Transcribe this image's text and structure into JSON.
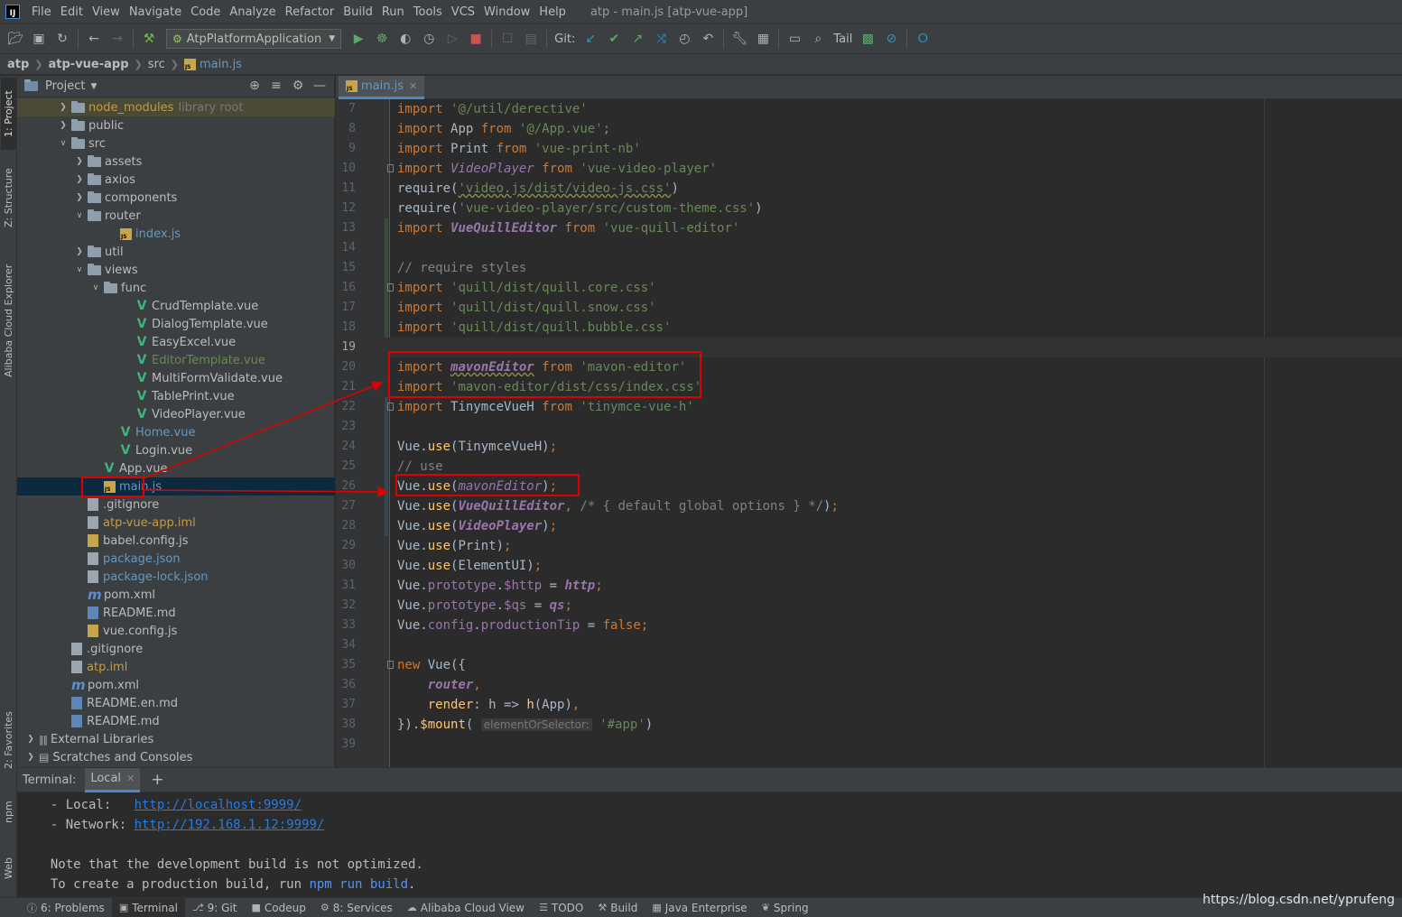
{
  "menubar": {
    "items": [
      "File",
      "Edit",
      "View",
      "Navigate",
      "Code",
      "Analyze",
      "Refactor",
      "Build",
      "Run",
      "Tools",
      "VCS",
      "Window",
      "Help"
    ],
    "window_title": "atp - main.js [atp-vue-app]"
  },
  "toolbar": {
    "run_config": "AtpPlatformApplication",
    "git_label": "Git:",
    "tail_label": "Tail"
  },
  "breadcrumb": {
    "items": [
      "atp",
      "atp-vue-app",
      "src",
      "main.js"
    ]
  },
  "left_strip": {
    "tabs": [
      "1: Project",
      "Z: Structure",
      "Alibaba Cloud Explorer",
      "2: Favorites",
      "npm",
      "Web"
    ]
  },
  "project_panel": {
    "title": "Project",
    "tree": [
      {
        "label": "node_modules",
        "suffix": "library root",
        "depth": 2,
        "type": "folder",
        "expanded": false,
        "style": "excluded"
      },
      {
        "label": "public",
        "depth": 2,
        "type": "folder",
        "expanded": false
      },
      {
        "label": "src",
        "depth": 2,
        "type": "folder",
        "expanded": true
      },
      {
        "label": "assets",
        "depth": 3,
        "type": "folder",
        "expanded": false
      },
      {
        "label": "axios",
        "depth": 3,
        "type": "folder",
        "expanded": false
      },
      {
        "label": "components",
        "depth": 3,
        "type": "folder",
        "expanded": false
      },
      {
        "label": "router",
        "depth": 3,
        "type": "folder",
        "expanded": true
      },
      {
        "label": "index.js",
        "depth": 5,
        "type": "js",
        "color": "blue"
      },
      {
        "label": "util",
        "depth": 3,
        "type": "folder",
        "expanded": false
      },
      {
        "label": "views",
        "depth": 3,
        "type": "folder",
        "expanded": true
      },
      {
        "label": "func",
        "depth": 4,
        "type": "folder",
        "expanded": true
      },
      {
        "label": "CrudTemplate.vue",
        "depth": 6,
        "type": "vue"
      },
      {
        "label": "DialogTemplate.vue",
        "depth": 6,
        "type": "vue"
      },
      {
        "label": "EasyExcel.vue",
        "depth": 6,
        "type": "vue"
      },
      {
        "label": "EditorTemplate.vue",
        "depth": 6,
        "type": "vue",
        "color": "green"
      },
      {
        "label": "MultiFormValidate.vue",
        "depth": 6,
        "type": "vue"
      },
      {
        "label": "TablePrint.vue",
        "depth": 6,
        "type": "vue"
      },
      {
        "label": "VideoPlayer.vue",
        "depth": 6,
        "type": "vue"
      },
      {
        "label": "Home.vue",
        "depth": 5,
        "type": "vue",
        "color": "blue"
      },
      {
        "label": "Login.vue",
        "depth": 5,
        "type": "vue"
      },
      {
        "label": "App.vue",
        "depth": 4,
        "type": "vue"
      },
      {
        "label": "main.js",
        "depth": 4,
        "type": "js",
        "color": "blue",
        "selected": true
      },
      {
        "label": ".gitignore",
        "depth": 3,
        "type": "file"
      },
      {
        "label": "atp-vue-app.iml",
        "depth": 3,
        "type": "file",
        "color": "orange"
      },
      {
        "label": "babel.config.js",
        "depth": 3,
        "type": "jsfile"
      },
      {
        "label": "package.json",
        "depth": 3,
        "type": "file",
        "color": "blue"
      },
      {
        "label": "package-lock.json",
        "depth": 3,
        "type": "file",
        "color": "blue"
      },
      {
        "label": "pom.xml",
        "depth": 3,
        "type": "maven"
      },
      {
        "label": "README.md",
        "depth": 3,
        "type": "md"
      },
      {
        "label": "vue.config.js",
        "depth": 3,
        "type": "jsfile"
      },
      {
        "label": ".gitignore",
        "depth": 2,
        "type": "file"
      },
      {
        "label": "atp.iml",
        "depth": 2,
        "type": "file",
        "color": "orange"
      },
      {
        "label": "pom.xml",
        "depth": 2,
        "type": "maven"
      },
      {
        "label": "README.en.md",
        "depth": 2,
        "type": "md"
      },
      {
        "label": "README.md",
        "depth": 2,
        "type": "md"
      },
      {
        "label": "External Libraries",
        "depth": 0,
        "type": "lib",
        "expanded": false
      },
      {
        "label": "Scratches and Consoles",
        "depth": 0,
        "type": "scratch",
        "expanded": false
      }
    ]
  },
  "editor": {
    "tab_label": "main.js",
    "lines": [
      {
        "n": "7",
        "seg": [
          [
            "kw",
            "import "
          ],
          [
            "str",
            "'@/util/derective'"
          ]
        ]
      },
      {
        "n": "8",
        "seg": [
          [
            "kw",
            "import "
          ],
          [
            "pl",
            "App "
          ],
          [
            "kw",
            "from "
          ],
          [
            "str",
            "'@/App.vue'"
          ],
          [
            "kw",
            ";"
          ]
        ]
      },
      {
        "n": "9",
        "seg": [
          [
            "kw",
            "import "
          ],
          [
            "pl",
            "Print "
          ],
          [
            "kw",
            "from "
          ],
          [
            "str",
            "'vue-print-nb'"
          ]
        ]
      },
      {
        "n": "10",
        "fold": true,
        "seg": [
          [
            "kw",
            "import "
          ],
          [
            "ital",
            "VideoPlayer "
          ],
          [
            "kw",
            "from "
          ],
          [
            "str",
            "'vue-video-player'"
          ]
        ]
      },
      {
        "n": "11",
        "seg": [
          [
            "pl",
            "require("
          ],
          [
            "strsq",
            "'video.js/dist/video-js.css'"
          ],
          [
            "pl",
            ")"
          ]
        ]
      },
      {
        "n": "12",
        "seg": [
          [
            "pl",
            "require("
          ],
          [
            "str",
            "'vue-video-player/src/custom-theme.css'"
          ],
          [
            "pl",
            ")"
          ]
        ]
      },
      {
        "n": "13",
        "mark": "green",
        "seg": [
          [
            "kw",
            "import "
          ],
          [
            "itb",
            "VueQuillEditor "
          ],
          [
            "kw",
            "from "
          ],
          [
            "str",
            "'vue-quill-editor'"
          ]
        ]
      },
      {
        "n": "14",
        "mark": "green",
        "seg": []
      },
      {
        "n": "15",
        "mark": "green",
        "seg": [
          [
            "cmt",
            "// require styles"
          ]
        ]
      },
      {
        "n": "16",
        "mark": "green",
        "fold": true,
        "seg": [
          [
            "kw",
            "import "
          ],
          [
            "str",
            "'quill/dist/quill.core.css'"
          ]
        ]
      },
      {
        "n": "17",
        "mark": "green",
        "seg": [
          [
            "kw",
            "import "
          ],
          [
            "str",
            "'quill/dist/quill.snow.css'"
          ]
        ]
      },
      {
        "n": "18",
        "mark": "green",
        "seg": [
          [
            "kw",
            "import "
          ],
          [
            "str",
            "'quill/dist/quill.bubble.css'"
          ]
        ]
      },
      {
        "n": "19",
        "current": true,
        "seg": []
      },
      {
        "n": "20",
        "seg": [
          [
            "kw",
            "import "
          ],
          [
            "itbsq",
            "mavonEditor"
          ],
          [
            "pl",
            " "
          ],
          [
            "kw",
            "from "
          ],
          [
            "str",
            "'mavon-editor'"
          ]
        ]
      },
      {
        "n": "21",
        "seg": [
          [
            "kw",
            "import "
          ],
          [
            "str",
            "'mavon-editor/dist/css/index.css'"
          ]
        ]
      },
      {
        "n": "22",
        "fold": true,
        "mark": "blue",
        "seg": [
          [
            "kw",
            "import "
          ],
          [
            "pl",
            "TinymceVueH "
          ],
          [
            "kw",
            "from "
          ],
          [
            "str",
            "'tinymce-vue-h'"
          ]
        ]
      },
      {
        "n": "23",
        "mark": "blue",
        "seg": []
      },
      {
        "n": "24",
        "mark": "blue",
        "seg": [
          [
            "pl",
            "Vue."
          ],
          [
            "fn",
            "use"
          ],
          [
            "pl",
            "(TinymceVueH)"
          ],
          [
            "kw",
            ";"
          ]
        ]
      },
      {
        "n": "25",
        "mark": "blue",
        "seg": [
          [
            "cmt",
            "// use"
          ]
        ]
      },
      {
        "n": "26",
        "mark": "blue",
        "seg": [
          [
            "pl",
            "Vue."
          ],
          [
            "fn",
            "use"
          ],
          [
            "pl",
            "("
          ],
          [
            "ital",
            "mavonEditor"
          ],
          [
            "pl",
            ")"
          ],
          [
            "kw",
            ";"
          ]
        ]
      },
      {
        "n": "27",
        "mark": "blue",
        "seg": [
          [
            "pl",
            "Vue."
          ],
          [
            "fn",
            "use"
          ],
          [
            "pl",
            "("
          ],
          [
            "itb",
            "VueQuillEditor"
          ],
          [
            "kw",
            ", "
          ],
          [
            "cmt",
            "/* { default global options } */"
          ],
          [
            "pl",
            ")"
          ],
          [
            "kw",
            ";"
          ]
        ]
      },
      {
        "n": "28",
        "mark": "blue",
        "seg": [
          [
            "pl",
            "Vue."
          ],
          [
            "fn",
            "use"
          ],
          [
            "pl",
            "("
          ],
          [
            "itb",
            "VideoPlayer"
          ],
          [
            "pl",
            ")"
          ],
          [
            "kw",
            ";"
          ]
        ]
      },
      {
        "n": "29",
        "seg": [
          [
            "pl",
            "Vue."
          ],
          [
            "fn",
            "use"
          ],
          [
            "pl",
            "(Print)"
          ],
          [
            "kw",
            ";"
          ]
        ]
      },
      {
        "n": "30",
        "seg": [
          [
            "pl",
            "Vue."
          ],
          [
            "fn",
            "use"
          ],
          [
            "pl",
            "(ElementUI)"
          ],
          [
            "kw",
            ";"
          ]
        ]
      },
      {
        "n": "31",
        "seg": [
          [
            "pl",
            "Vue."
          ],
          [
            "prop",
            "prototype"
          ],
          [
            "pl",
            "."
          ],
          [
            "prop",
            "$http"
          ],
          [
            "pl",
            " = "
          ],
          [
            "itb",
            "http"
          ],
          [
            "kw",
            ";"
          ]
        ]
      },
      {
        "n": "32",
        "seg": [
          [
            "pl",
            "Vue."
          ],
          [
            "prop",
            "prototype"
          ],
          [
            "pl",
            "."
          ],
          [
            "prop",
            "$qs"
          ],
          [
            "pl",
            " = "
          ],
          [
            "itb",
            "qs"
          ],
          [
            "kw",
            ";"
          ]
        ]
      },
      {
        "n": "33",
        "seg": [
          [
            "pl",
            "Vue."
          ],
          [
            "prop",
            "config"
          ],
          [
            "pl",
            "."
          ],
          [
            "prop",
            "productionTip"
          ],
          [
            "pl",
            " = "
          ],
          [
            "kw",
            "false;"
          ]
        ]
      },
      {
        "n": "34",
        "seg": []
      },
      {
        "n": "35",
        "fold": true,
        "seg": [
          [
            "kw",
            "new "
          ],
          [
            "pl",
            "Vue({"
          ]
        ]
      },
      {
        "n": "36",
        "seg": [
          [
            "pl",
            "    "
          ],
          [
            "itb",
            "router"
          ],
          [
            "kw",
            ","
          ]
        ]
      },
      {
        "n": "37",
        "seg": [
          [
            "pl",
            "    "
          ],
          [
            "fn",
            "render"
          ],
          [
            "pl",
            ": h => "
          ],
          [
            "fn",
            "h"
          ],
          [
            "pl",
            "(App)"
          ],
          [
            "kw",
            ","
          ]
        ]
      },
      {
        "n": "38",
        "seg": [
          [
            "pl",
            "})."
          ],
          [
            "fn",
            "$mount"
          ],
          [
            "pl",
            "( "
          ],
          [
            "hint",
            "elementOrSelector:"
          ],
          [
            "pl",
            " "
          ],
          [
            "str",
            "'#app'"
          ],
          [
            "pl",
            ")"
          ]
        ]
      },
      {
        "n": "39",
        "seg": []
      }
    ]
  },
  "terminal": {
    "label": "Terminal:",
    "tab": "Local",
    "lines": [
      {
        "parts": [
          [
            "t",
            "  - Local:   "
          ],
          [
            "link",
            "http://localhost:9999/"
          ]
        ]
      },
      {
        "parts": [
          [
            "t",
            "  - Network: "
          ],
          [
            "link",
            "http://192.168.1.12:9999/"
          ]
        ]
      },
      {
        "parts": []
      },
      {
        "parts": [
          [
            "t",
            "  Note that the development build is not optimized."
          ]
        ]
      },
      {
        "parts": [
          [
            "t",
            "  To create a production build, run "
          ],
          [
            "cmd",
            "npm run build"
          ],
          [
            "t",
            "."
          ]
        ]
      }
    ]
  },
  "statusbar": {
    "items": [
      {
        "label": "6: Problems",
        "icon": "problems-icon"
      },
      {
        "label": "Terminal",
        "icon": "terminal-icon",
        "active": true
      },
      {
        "label": "9: Git",
        "icon": "git-icon"
      },
      {
        "label": "Codeup",
        "icon": "codeup-icon"
      },
      {
        "label": "8: Services",
        "icon": "services-icon"
      },
      {
        "label": "Alibaba Cloud View",
        "icon": "cloud-icon"
      },
      {
        "label": "TODO",
        "icon": "todo-icon"
      },
      {
        "label": "Build",
        "icon": "build-icon"
      },
      {
        "label": "Java Enterprise",
        "icon": "java-enterprise-icon"
      },
      {
        "label": "Spring",
        "icon": "spring-icon"
      }
    ],
    "watermark": "https://blog.csdn.net/yprufeng"
  },
  "colors": {
    "annotation_red": "#e00000",
    "selection": "#0d293e",
    "accent": "#4a88c7"
  }
}
